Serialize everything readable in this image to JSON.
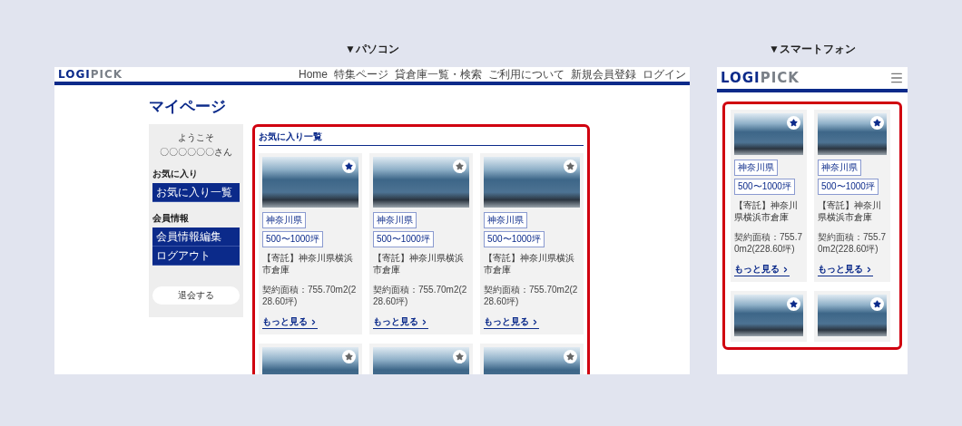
{
  "pc": {
    "label": "▼パソコン",
    "logo": {
      "part_1": "LOGI",
      "part_2": "PICK"
    },
    "nav": [
      "Home",
      "特集ページ",
      "貸倉庫一覧・検索",
      "ご利用について",
      "新規会員登録",
      "ログイン"
    ],
    "page_title": "マイページ",
    "sidebar": {
      "greeting": "ようこそ",
      "user": "〇〇〇〇〇〇さん",
      "groups": [
        {
          "heading": "お気に入り",
          "items": [
            "お気に入り一覧"
          ]
        },
        {
          "heading": "会員情報",
          "items": [
            "会員情報編集",
            "ログアウト"
          ]
        }
      ],
      "withdraw_button": "退会する"
    },
    "favorites": {
      "heading": "お気に入り一覧",
      "cards": [
        {
          "favorite": true,
          "tags": [
            "神奈川県",
            "500〜1000坪"
          ],
          "title": "【寄託】神奈川県横浜市倉庫",
          "area": "契約面積：755.70m2(228.60坪)",
          "link": "もっと見る"
        },
        {
          "favorite": false,
          "tags": [
            "神奈川県",
            "500〜1000坪"
          ],
          "title": "【寄託】神奈川県横浜市倉庫",
          "area": "契約面積：755.70m2(228.60坪)",
          "link": "もっと見る"
        },
        {
          "favorite": false,
          "tags": [
            "神奈川県",
            "500〜1000坪"
          ],
          "title": "【寄託】神奈川県横浜市倉庫",
          "area": "契約面積：755.70m2(228.60坪)",
          "link": "もっと見る"
        },
        {
          "favorite": false
        },
        {
          "favorite": false
        },
        {
          "favorite": false
        }
      ]
    }
  },
  "sp": {
    "label": "▼スマートフォン",
    "logo": {
      "part_1": "LOGI",
      "part_2": "PICK"
    },
    "cards": [
      {
        "favorite": true,
        "tags": [
          "神奈川県",
          "500〜1000坪"
        ],
        "title": "【寄託】神奈川県横浜市倉庫",
        "area": "契約面積：755.70m2(228.60坪)",
        "link": "もっと見る"
      },
      {
        "favorite": true,
        "tags": [
          "神奈川県",
          "500〜1000坪"
        ],
        "title": "【寄託】神奈川県横浜市倉庫",
        "area": "契約面積：755.70m2(228.60坪)",
        "link": "もっと見る"
      },
      {
        "favorite": true
      },
      {
        "favorite": true
      }
    ]
  }
}
